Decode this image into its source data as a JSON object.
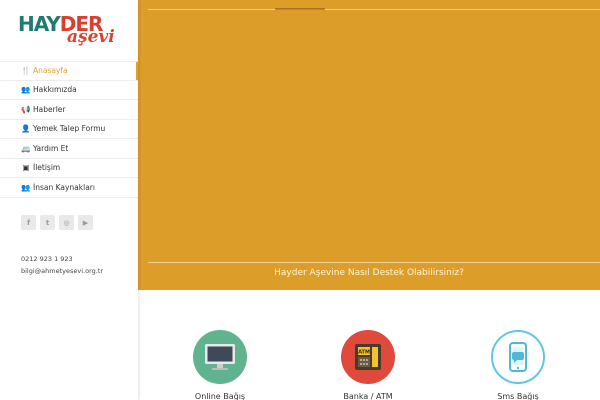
{
  "logo": {
    "part1": "HAY",
    "part2": "DER",
    "part3": "aşevi"
  },
  "menu": [
    {
      "label": "Anasayfa",
      "icon": "utensils-icon",
      "glyph": "🍴",
      "active": true
    },
    {
      "label": "Hakkımızda",
      "icon": "users-icon",
      "glyph": "👥",
      "active": false
    },
    {
      "label": "Haberler",
      "icon": "megaphone-icon",
      "glyph": "📢",
      "active": false
    },
    {
      "label": "Yemek Talep Formu",
      "icon": "user-form-icon",
      "glyph": "👤",
      "active": false
    },
    {
      "label": "Yardım Et",
      "icon": "van-icon",
      "glyph": "🚐",
      "active": false
    },
    {
      "label": "İletişim",
      "icon": "address-card-icon",
      "glyph": "▣",
      "active": false
    },
    {
      "label": "İnsan Kaynakları",
      "icon": "team-icon",
      "glyph": "👥",
      "active": false
    }
  ],
  "social": [
    {
      "icon": "facebook-icon",
      "glyph": "f"
    },
    {
      "icon": "twitter-icon",
      "glyph": "t"
    },
    {
      "icon": "instagram-icon",
      "glyph": "◎"
    },
    {
      "icon": "youtube-icon",
      "glyph": "▶"
    }
  ],
  "contact": {
    "phone": "0212 923 1 923",
    "email": "bilgi@ahmetyesevi.org.tr"
  },
  "hero": {
    "caption": "Hayder Aşevine Nasıl Destek Olabilirsiniz?"
  },
  "donate": [
    {
      "label": "Online Bağış",
      "icon": "monitor-icon"
    },
    {
      "label": "Banka / ATM",
      "icon": "atm-icon",
      "atm_text": "ATM"
    },
    {
      "label": "Sms Bağış",
      "icon": "phone-sms-icon"
    }
  ],
  "colors": {
    "accent": "#e3a02c",
    "hero": "#dc9e28",
    "teal": "#1f7a72",
    "red": "#d8402f"
  }
}
